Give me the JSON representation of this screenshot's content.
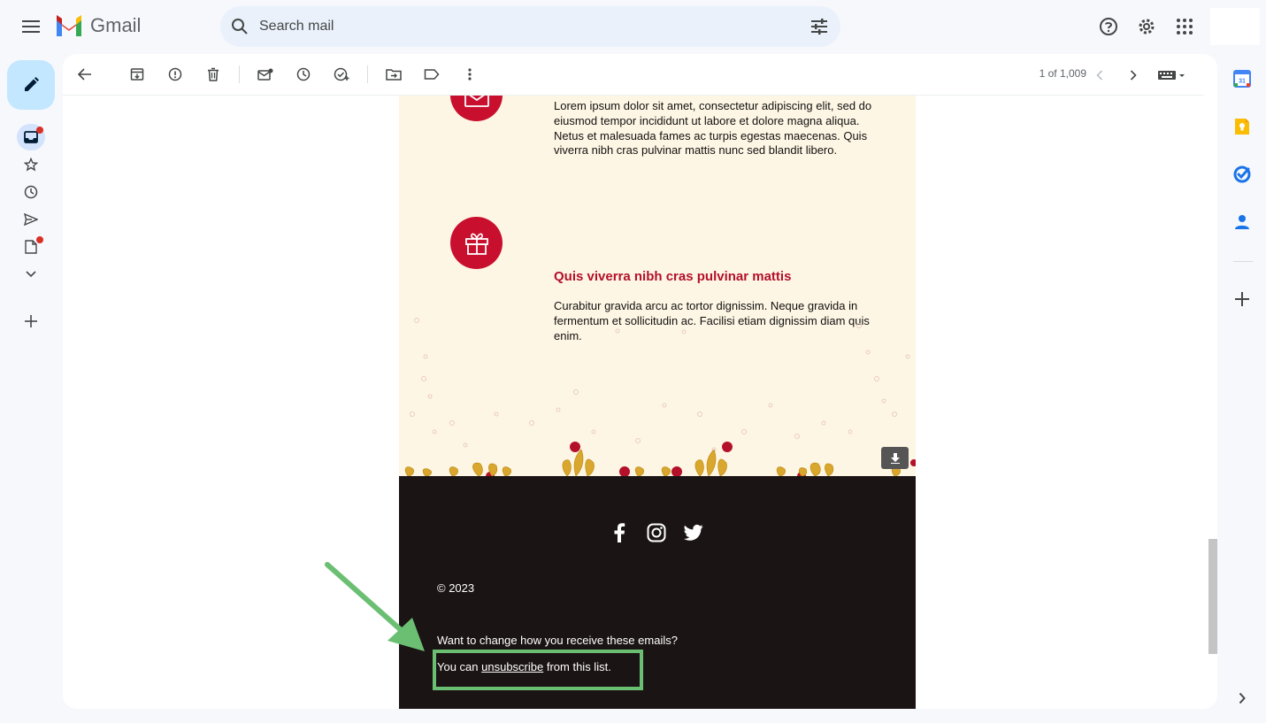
{
  "header": {
    "app_name": "Gmail",
    "search_placeholder": "Search mail"
  },
  "toolbar": {
    "pager": "1 of 1,009"
  },
  "email": {
    "feature1": {
      "body": "Lorem ipsum dolor sit amet, consectetur adipiscing elit, sed do eiusmod tempor incididunt ut labore et dolore magna aliqua. Netus et malesuada fames ac turpis egestas maecenas. Quis viverra nibh cras pulvinar mattis nunc sed blandit libero."
    },
    "feature2": {
      "title": "Quis viverra nibh cras pulvinar mattis",
      "body": "Curabitur gravida arcu ac tortor dignissim. Neque gravida in fermentum et sollicitudin ac. Facilisi etiam dignissim diam quis enim."
    },
    "footer": {
      "copyright": "© 2023",
      "prefs_question": "Want to change how you receive these emails?",
      "unsub_prefix": "You can ",
      "unsub_link": "unsubscribe",
      "unsub_suffix": " from this list."
    }
  },
  "side_panel": {
    "calendar_day": "31"
  },
  "colors": {
    "accent_red": "#c8102e",
    "email_bg": "#fef6e4",
    "footer_bg": "#1b1414",
    "highlight_green": "#6bbf73",
    "compose_bg": "#c2e7ff"
  },
  "icons": {
    "social": [
      "facebook-icon",
      "instagram-icon",
      "twitter-icon"
    ]
  }
}
